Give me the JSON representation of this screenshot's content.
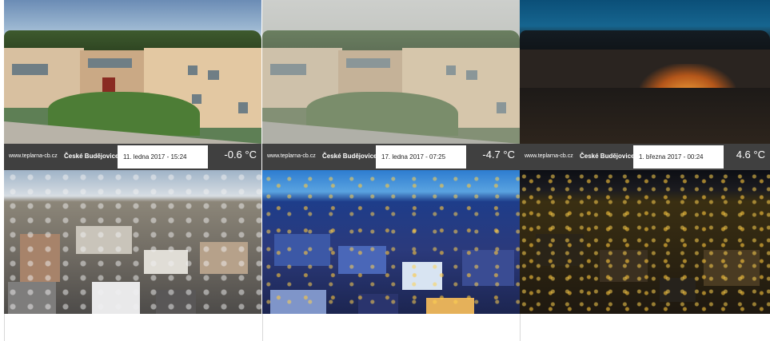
{
  "cams": [
    {
      "site": "www.teplarna-cb.cz",
      "city": "České Budějovice",
      "date": "11. ledna 2017 - 15:24",
      "temp": "-0.6 °C"
    },
    {
      "site": "www.teplarna-cb.cz",
      "city": "České Budějovice",
      "date": "17. ledna 2017 - 07:25",
      "temp": "-4.7 °C"
    },
    {
      "site": "www.teplarna-cb.cz",
      "city": "České Budějovice",
      "date": "1. března 2017 - 00:24",
      "temp": "4.6 °C"
    }
  ]
}
